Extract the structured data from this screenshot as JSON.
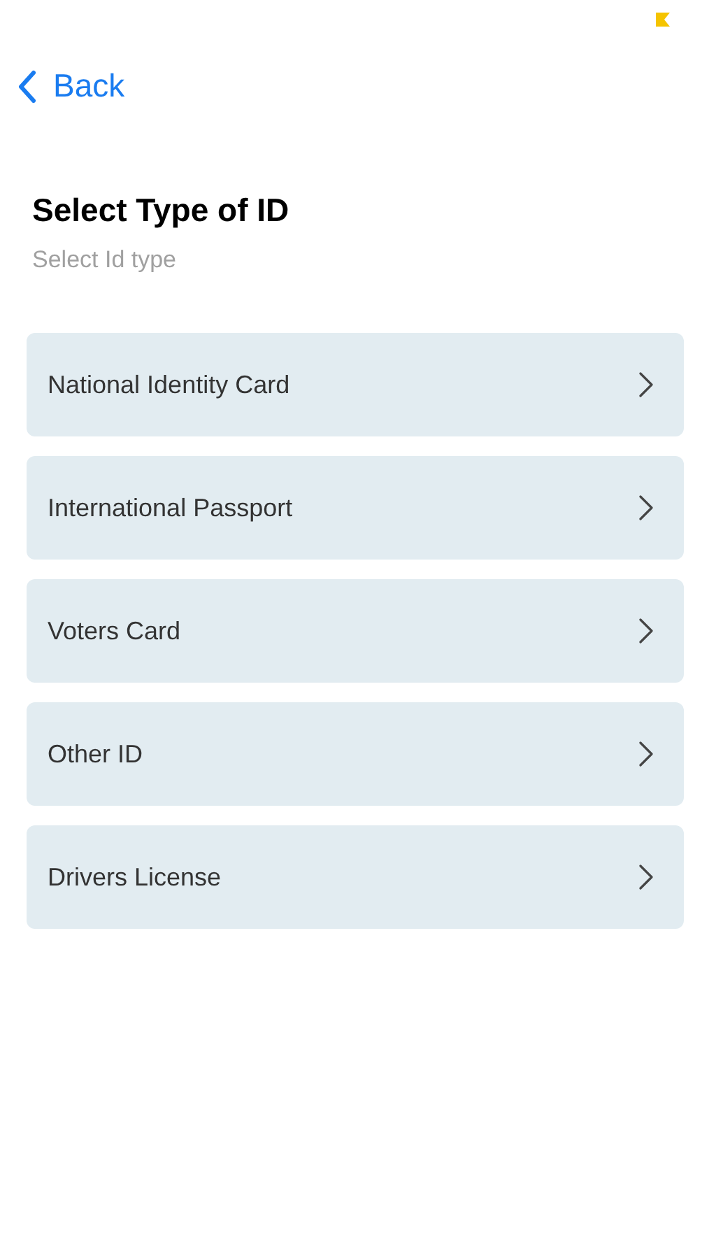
{
  "nav": {
    "back": "Back"
  },
  "header": {
    "title": "Select Type of ID",
    "subtitle": "Select Id type"
  },
  "options": [
    {
      "label": "National Identity Card"
    },
    {
      "label": "International Passport"
    },
    {
      "label": "Voters Card"
    },
    {
      "label": "Other ID"
    },
    {
      "label": "Drivers License"
    }
  ]
}
